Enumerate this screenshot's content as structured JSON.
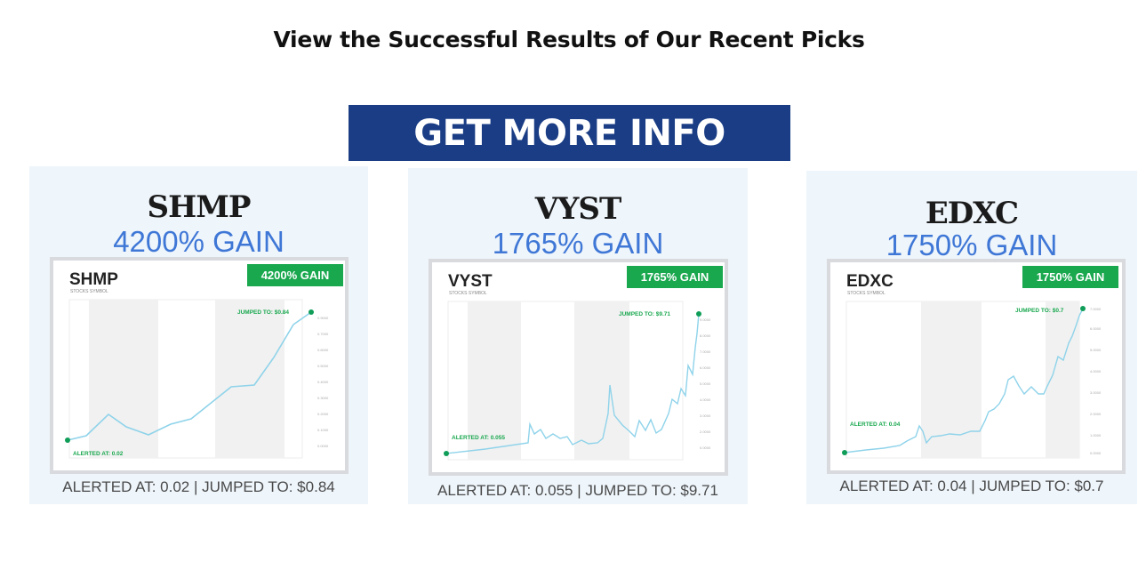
{
  "heading": "View the Successful Results of Our Recent Picks",
  "cta": {
    "label": "GET MORE INFO"
  },
  "colors": {
    "cta_bg": "#1a3d85",
    "gain_text": "#3f77d6",
    "badge_bg": "#1aa84f",
    "line": "#8fd3ea",
    "marker": "#0f9d58"
  },
  "cards": [
    {
      "symbol": "SHMP",
      "gain": "4200% GAIN",
      "caption": "ALERTED AT: 0.02 | JUMPED TO: $0.84",
      "chart": {
        "symbol": "SHMP",
        "sub": "STOCKS SYMBOL",
        "badge": "4200% GAIN",
        "start_label": "ALERTED AT: 0.02",
        "end_label": "JUMPED TO: $0.84"
      }
    },
    {
      "symbol": "VYST",
      "gain": "1765% GAIN",
      "caption": "ALERTED AT: 0.055 | JUMPED TO: $9.71",
      "chart": {
        "symbol": "VYST",
        "sub": "STOCKS SYMBOL",
        "badge": "1765% GAIN",
        "start_label": "ALERTED AT: 0.055",
        "end_label": "JUMPED TO: $9.71"
      }
    },
    {
      "symbol": "EDXC",
      "gain": "1750% GAIN",
      "caption": "ALERTED AT: 0.04 | JUMPED TO: $0.7",
      "chart": {
        "symbol": "EDXC",
        "sub": "STOCKS SYMBOL",
        "badge": "1750% GAIN",
        "start_label": "ALERTED AT: 0.04",
        "end_label": "JUMPED TO: $0.7"
      }
    }
  ]
}
